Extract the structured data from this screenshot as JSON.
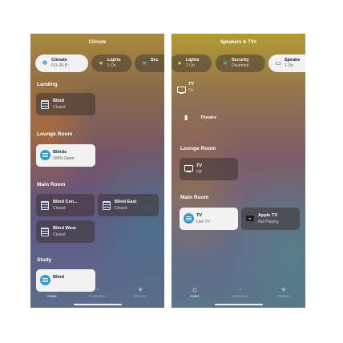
{
  "left": {
    "title": "Climate",
    "pills": [
      {
        "title": "Climate",
        "subtitle": "0.0–26.5°"
      },
      {
        "title": "Lights",
        "subtitle": "1 On"
      },
      {
        "title": "Sec"
      }
    ],
    "sections": {
      "landing": "Landing",
      "lounge": "Lounge Room",
      "main": "Main Room",
      "study": "Study"
    },
    "tiles": {
      "landing_blind": {
        "name": "Blind",
        "status": "Closed"
      },
      "lounge_blinds": {
        "name": "Blinds",
        "status": "100% Open"
      },
      "blind_centre": {
        "name": "Blind Cen...",
        "status": "Closed"
      },
      "blind_east": {
        "name": "Blind East",
        "status": "Closed"
      },
      "blind_west": {
        "name": "Blind West",
        "status": "Closed"
      },
      "study_blind": {
        "name": "Blind"
      }
    },
    "tabs": {
      "home": "Home",
      "automation": "Automation",
      "discover": "Discover"
    }
  },
  "right": {
    "title": "Speakers & TVs",
    "pills": [
      {
        "title": "Lights",
        "subtitle": "1 On"
      },
      {
        "title": "Security",
        "subtitle": "Disarmed"
      },
      {
        "title": "Speake",
        "subtitle": "1 On"
      }
    ],
    "top_tv": {
      "name": "TV",
      "status": "On"
    },
    "theatre": {
      "name": "Theatre"
    },
    "sections": {
      "lounge": "Lounge Room",
      "main": "Main Room"
    },
    "tiles": {
      "lounge_tv": {
        "name": "TV",
        "status": "Off"
      },
      "main_tv": {
        "name": "TV",
        "status": "Live TV"
      },
      "apple_tv": {
        "name": "Apple TV",
        "status": "Not Playing"
      }
    },
    "tabs": {
      "home": "Home",
      "automation": "Automation",
      "discover": "Discover"
    }
  },
  "icons": {
    "climate": "fan-icon",
    "lights": "lightbulb-icon",
    "security": "lock-icon",
    "speakers": "speaker-icon",
    "blind": "blind-icon",
    "tv": "tv-icon",
    "theatre": "theatre-icon",
    "apple_tv": "apple-tv-icon",
    "home_tab": "house-icon",
    "automation_tab": "clock-check-icon",
    "discover_tab": "star-icon"
  },
  "colors": {
    "accent_blue": "#2f9ad8",
    "lights_yellow": "#f2c230",
    "security_teal": "#3ab0a0"
  }
}
